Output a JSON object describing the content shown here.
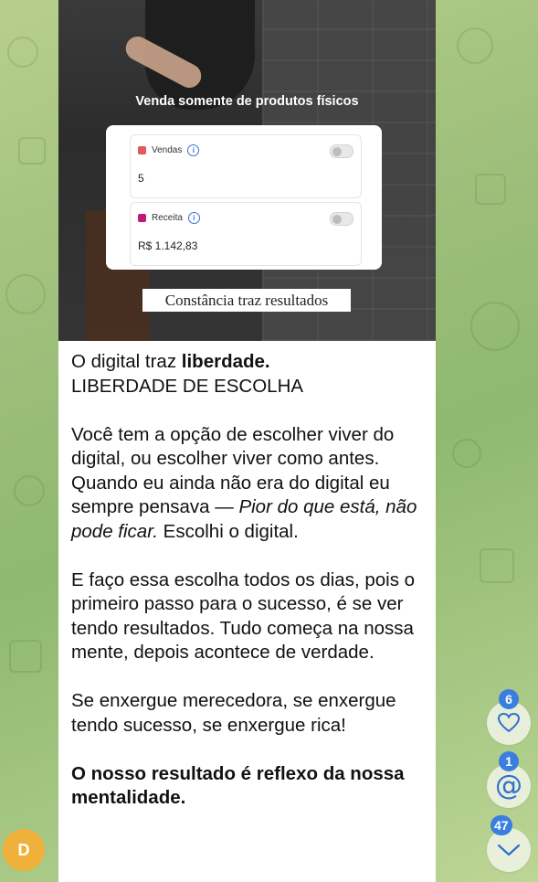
{
  "post_image": {
    "title": "Venda somente de produtos físicos",
    "metrics": [
      {
        "label": "Vendas",
        "value": "5",
        "color": "#e05a5a"
      },
      {
        "label": "Receita",
        "value": "R$ 1.142,83",
        "color": "#c2187a"
      }
    ],
    "caption": "Constância traz resultados"
  },
  "message": {
    "p1_normal": "O digital traz ",
    "p1_bold": "liberdade.",
    "p1_line2": "LIBERDADE DE ESCOLHA",
    "p2_part1": "Você tem a opção de escolher viver do digital, ou escolher viver como antes. Quando eu ainda não era do digital eu sempre pensava — ",
    "p2_italic": "Pior do que está, não pode ficar.",
    "p2_part2": " Escolhi o digital.",
    "p3": "E faço essa escolha todos os dias, pois o primeiro passo para o sucesso, é se ver tendo resultados. Tudo começa na nossa mente, depois acontece de verdade.",
    "p4": "Se enxergue merecedora, se enxergue tendo sucesso, se enxergue rica!",
    "p5_bold": "O nosso resultado é reflexo da nossa mentalidade."
  },
  "side_buttons": {
    "reactions_count": "6",
    "mentions_count": "1",
    "unread_count": "47"
  },
  "avatar_letter": "D",
  "colors": {
    "accent": "#3a7fe0",
    "avatar": "#f0b13b"
  }
}
